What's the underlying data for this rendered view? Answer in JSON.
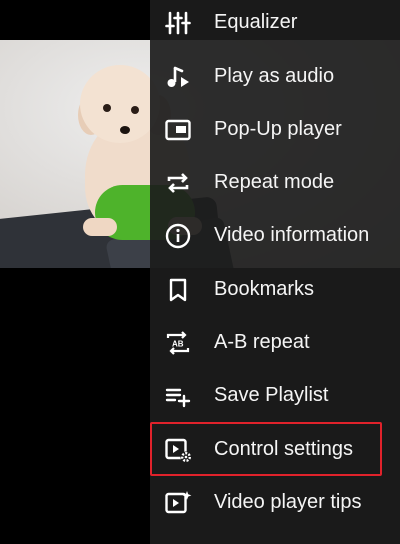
{
  "menu": {
    "items": [
      {
        "label": "Equalizer",
        "icon": "equalizer-icon"
      },
      {
        "label": "Play as audio",
        "icon": "music-note-play-icon"
      },
      {
        "label": "Pop-Up player",
        "icon": "popup-player-icon"
      },
      {
        "label": "Repeat mode",
        "icon": "repeat-icon"
      },
      {
        "label": "Video information",
        "icon": "info-icon"
      },
      {
        "label": "Bookmarks",
        "icon": "bookmark-icon"
      },
      {
        "label": "A-B repeat",
        "icon": "ab-repeat-icon"
      },
      {
        "label": "Save Playlist",
        "icon": "playlist-add-icon"
      },
      {
        "label": "Control settings",
        "icon": "control-settings-icon"
      },
      {
        "label": "Video player tips",
        "icon": "video-tips-icon"
      }
    ]
  },
  "colors": {
    "menu_background": "#1c1c1c",
    "text": "#f5f5f5",
    "highlight": "#e0222b"
  }
}
